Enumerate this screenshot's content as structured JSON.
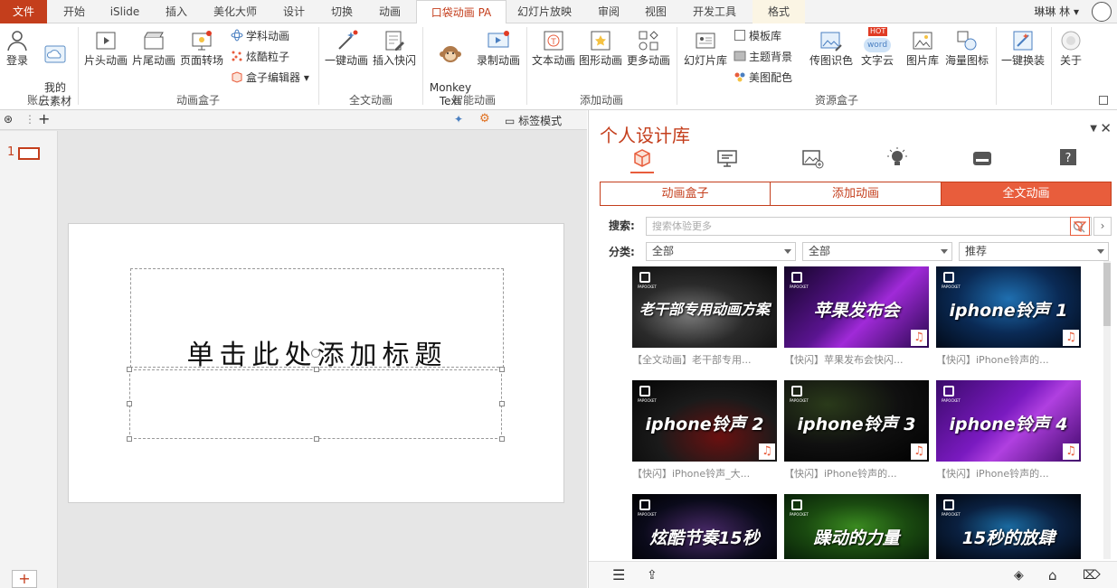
{
  "tabs": [
    {
      "label": "文件"
    },
    {
      "label": "开始"
    },
    {
      "label": "iSlide"
    },
    {
      "label": "插入"
    },
    {
      "label": "美化大师"
    },
    {
      "label": "设计"
    },
    {
      "label": "切换"
    },
    {
      "label": "动画"
    },
    {
      "label": "口袋动画 PA"
    },
    {
      "label": "幻灯片放映"
    },
    {
      "label": "审阅"
    },
    {
      "label": "视图"
    },
    {
      "label": "开发工具"
    },
    {
      "label": "格式"
    }
  ],
  "user": {
    "name": "琳琳 林 ▾"
  },
  "ribbon": {
    "account": {
      "login": "登录",
      "my_assets": "我的\n云素材",
      "group": "账户"
    },
    "anim_box": {
      "intro": "片头动画",
      "outro": "片尾动画",
      "page_turn": "页面转场",
      "subject": "学科动画",
      "particle": "炫酷粒子",
      "box_editor": "盒子编辑器",
      "group": "动画盒子"
    },
    "full_anim": {
      "one_click": "一键动画",
      "insert_flash": "插入快闪",
      "group": "全文动画"
    },
    "smart_anim": {
      "monkey": "Monkey\nText",
      "record": "录制动画",
      "group": "智能动画"
    },
    "add_anim": {
      "text_anim": "文本动画",
      "shape_anim": "图形动画",
      "more_anim": "更多动画",
      "group": "添加动画"
    },
    "resources": {
      "slide_lib": "幻灯片库",
      "template_lib": "模板库",
      "theme_bg": "主题背景",
      "color_match": "美图配色",
      "pic_color": "传图识色",
      "text_cloud": "文字云",
      "pic_lib": "图片库",
      "icons": "海量图标",
      "group": "资源盒子",
      "hot": "HOT",
      "word": "word"
    },
    "one_click_skin": "一键换装",
    "about": "关于"
  },
  "left": {
    "tag_mode": "标签模式",
    "slide_number": "1",
    "title_placeholder": "单击此处添加标题"
  },
  "panel": {
    "title": "个人设计库",
    "subtabs": [
      {
        "label": "动画盒子"
      },
      {
        "label": "添加动画"
      },
      {
        "label": "全文动画"
      }
    ],
    "search_label": "搜索:",
    "search_placeholder": "搜索体验更多",
    "category_label": "分类:",
    "selects": [
      "全部",
      "全部",
      "推荐"
    ],
    "brand": "PAPOCKET",
    "cards": [
      {
        "title": "老干部专用动画方案",
        "caption": "【全文动画】老干部专用...",
        "music": false
      },
      {
        "title": "苹果发布会",
        "caption": "【快闪】苹果发布会快闪...",
        "music": true
      },
      {
        "title": "iphone铃声 1",
        "caption": "【快闪】iPhone铃声的...",
        "music": true
      },
      {
        "title": "iphone铃声 2",
        "caption": "【快闪】iPhone铃声_大...",
        "music": true
      },
      {
        "title": "iphone铃声 3",
        "caption": "【快闪】iPhone铃声的...",
        "music": true
      },
      {
        "title": "iphone铃声 4",
        "caption": "【快闪】iPhone铃声的...",
        "music": true
      },
      {
        "title": "炫酷节奏15秒",
        "caption": "",
        "music": false
      },
      {
        "title": "躁动的力量",
        "caption": "",
        "music": false
      },
      {
        "title": "15秒的放肆",
        "caption": "",
        "music": false
      }
    ]
  },
  "colors": {
    "accent": "#c43e1c",
    "accent_light": "#e85d3c"
  }
}
